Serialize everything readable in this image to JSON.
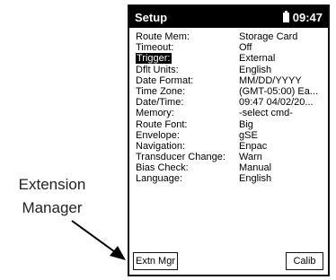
{
  "callout": {
    "line1": "Extension",
    "line2": "Manager"
  },
  "device": {
    "title": "Setup",
    "clock": "09:47",
    "rows": [
      {
        "label": "Route Mem:",
        "value": "Storage Card"
      },
      {
        "label": "Timeout:",
        "value": "Off"
      },
      {
        "label": "Trigger:",
        "value": "External",
        "selected": true
      },
      {
        "label": "Dflt Units:",
        "value": "English"
      },
      {
        "label": "Date Format:",
        "value": "MM/DD/YYYY"
      },
      {
        "label": "Time Zone:",
        "value": "(GMT-05:00) Ea..."
      },
      {
        "label": "Date/Time:",
        "value": "09:47 04/02/20..."
      },
      {
        "label": "Memory:",
        "value": "-select cmd-"
      },
      {
        "label": "Route Font:",
        "value": "Big"
      },
      {
        "label": "Envelope:",
        "value": "gSE"
      },
      {
        "label": "Navigation:",
        "value": "Enpac"
      },
      {
        "label": "Transducer Change:",
        "value": "Warn"
      },
      {
        "label": "Bias Check:",
        "value": "Manual"
      },
      {
        "label": "Language:",
        "value": "English"
      }
    ],
    "buttons": {
      "left": "Extn Mgr",
      "right": "Calib"
    }
  },
  "icons": {
    "battery": "battery-icon",
    "arrow": "arrow-icon"
  }
}
